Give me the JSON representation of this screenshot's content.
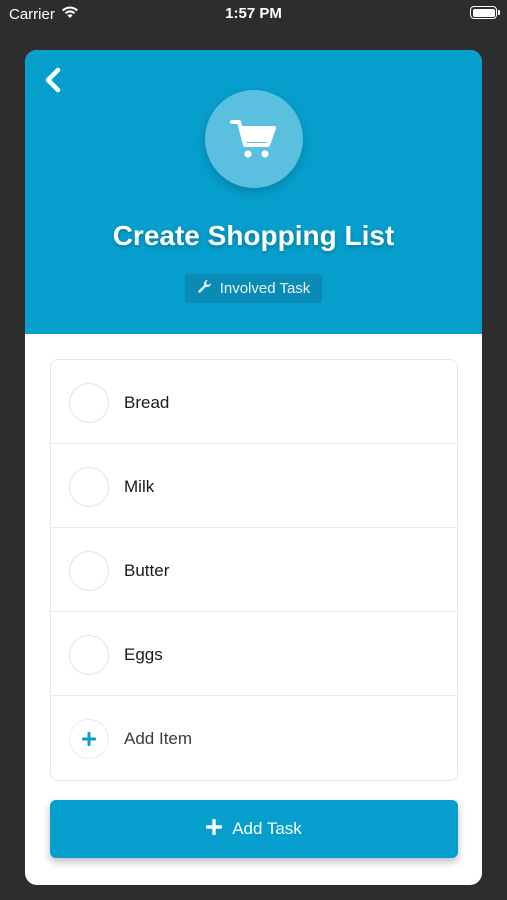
{
  "status_bar": {
    "carrier": "Carrier",
    "time": "1:57 PM",
    "wifi_icon": "wifi-icon",
    "battery_icon": "battery-icon"
  },
  "header": {
    "title": "Create Shopping List",
    "badge_label": "Involved Task",
    "badge_icon": "wrench-icon",
    "main_icon": "shopping-cart-icon",
    "back_icon": "chevron-left-icon",
    "color": "#069fcd"
  },
  "list": {
    "items": [
      {
        "label": "Bread"
      },
      {
        "label": "Milk"
      },
      {
        "label": "Butter"
      },
      {
        "label": "Eggs"
      }
    ],
    "add_item_label": "Add Item"
  },
  "footer": {
    "add_task_label": "Add Task"
  }
}
